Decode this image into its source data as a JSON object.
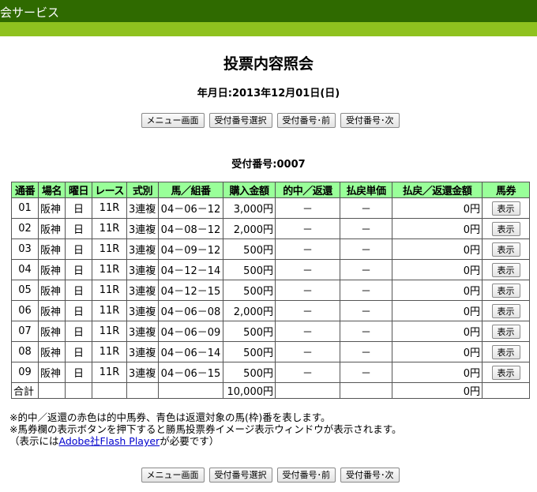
{
  "header": {
    "title": "会サービス"
  },
  "page": {
    "title": "投票内容照会",
    "date_line": "年月日:2013年12月01日(日)",
    "receipt_line": "受付番号:0007"
  },
  "nav": {
    "menu": "メニュー画面",
    "select": "受付番号選択",
    "prev": "受付番号･前",
    "next": "受付番号･次"
  },
  "table": {
    "headers": [
      "通番",
      "場名",
      "曜日",
      "レース",
      "式別",
      "馬／組番",
      "購入金額",
      "的中／返還",
      "払戻単価",
      "払戻／返還金額",
      "馬券"
    ],
    "show_label": "表示",
    "rows": [
      {
        "no": "01",
        "venue": "阪神",
        "day": "日",
        "race": "11R",
        "type": "3連複",
        "combo": "04－06－12",
        "amount": "3,000円",
        "hit": "－",
        "unit": "－",
        "payout": "0円"
      },
      {
        "no": "02",
        "venue": "阪神",
        "day": "日",
        "race": "11R",
        "type": "3連複",
        "combo": "04－08－12",
        "amount": "2,000円",
        "hit": "－",
        "unit": "－",
        "payout": "0円"
      },
      {
        "no": "03",
        "venue": "阪神",
        "day": "日",
        "race": "11R",
        "type": "3連複",
        "combo": "04－09－12",
        "amount": "500円",
        "hit": "－",
        "unit": "－",
        "payout": "0円"
      },
      {
        "no": "04",
        "venue": "阪神",
        "day": "日",
        "race": "11R",
        "type": "3連複",
        "combo": "04－12－14",
        "amount": "500円",
        "hit": "－",
        "unit": "－",
        "payout": "0円"
      },
      {
        "no": "05",
        "venue": "阪神",
        "day": "日",
        "race": "11R",
        "type": "3連複",
        "combo": "04－12－15",
        "amount": "500円",
        "hit": "－",
        "unit": "－",
        "payout": "0円"
      },
      {
        "no": "06",
        "venue": "阪神",
        "day": "日",
        "race": "11R",
        "type": "3連複",
        "combo": "04－06－08",
        "amount": "2,000円",
        "hit": "－",
        "unit": "－",
        "payout": "0円"
      },
      {
        "no": "07",
        "venue": "阪神",
        "day": "日",
        "race": "11R",
        "type": "3連複",
        "combo": "04－06－09",
        "amount": "500円",
        "hit": "－",
        "unit": "－",
        "payout": "0円"
      },
      {
        "no": "08",
        "venue": "阪神",
        "day": "日",
        "race": "11R",
        "type": "3連複",
        "combo": "04－06－14",
        "amount": "500円",
        "hit": "－",
        "unit": "－",
        "payout": "0円"
      },
      {
        "no": "09",
        "venue": "阪神",
        "day": "日",
        "race": "11R",
        "type": "3連複",
        "combo": "04－06－15",
        "amount": "500円",
        "hit": "－",
        "unit": "－",
        "payout": "0円"
      }
    ],
    "total": {
      "label": "合計",
      "amount": "10,000円",
      "payout": "0円"
    }
  },
  "notes": {
    "line1": "※的中／返還の赤色は的中馬券、青色は返還対象の馬(枠)番を表します。",
    "line2": "※馬券欄の表示ボタンを押下すると勝馬投票券イメージ表示ウィンドウが表示されます。",
    "line3_pre": "（表示には",
    "line3_link": "Adobe社Flash Player",
    "line3_post": "が必要です）"
  }
}
